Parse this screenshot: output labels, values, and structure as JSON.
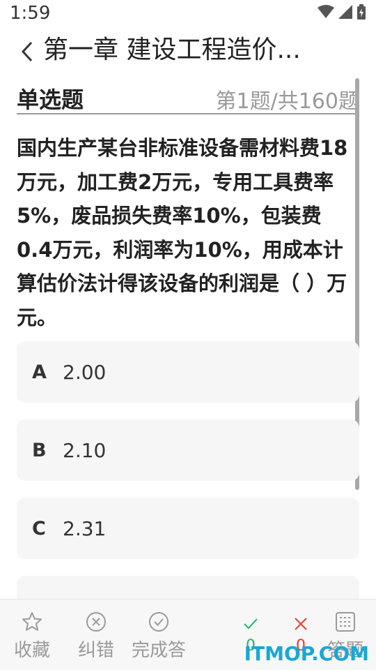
{
  "status_bar": {
    "time": "1:59"
  },
  "header": {
    "title": "第一章  建设工程造价..."
  },
  "section": {
    "type_label": "单选题",
    "counter": "第1题/共160题"
  },
  "question": {
    "text": "国内生产某台非标准设备需材料费18万元，加工费2万元，专用工具费率5%，废品损失费率10%，包装费0.4万元，利润率为10%，用成本计算估价法计得该设备的利润是（ ）万元。"
  },
  "options": [
    {
      "letter": "A",
      "text": "2.00"
    },
    {
      "letter": "B",
      "text": "2.10"
    },
    {
      "letter": "C",
      "text": "2.31"
    }
  ],
  "bottom_bar": {
    "favorite_label": "收藏",
    "report_error_label": "纠错",
    "finish_label": "完成答",
    "correct_count": "0",
    "wrong_count": "0",
    "answer_sheet_label": "答题",
    "colors": {
      "correct": "#1db86b",
      "wrong": "#e53935",
      "icon": "#9a9a9a"
    }
  },
  "watermark": {
    "text": "ITMOP.COM"
  }
}
